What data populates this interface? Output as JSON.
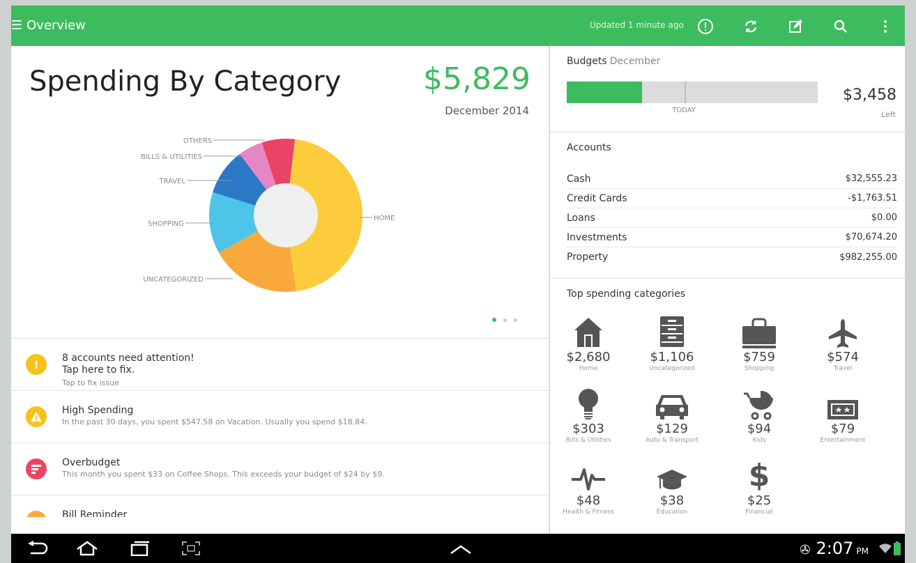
{
  "app": {
    "title": "Overview",
    "updated": "Updated 1 minute ago"
  },
  "toolbar": {
    "icons": [
      "alert-icon",
      "sync-icon",
      "compose-icon",
      "search-icon",
      "overflow-menu-icon"
    ]
  },
  "chart_title": "Spending By Category",
  "chart_total": "$5,829",
  "chart_period": "December 2014",
  "chart_data": {
    "type": "pie",
    "title": "Spending By Category",
    "categories": [
      "HOME",
      "UNCATEGORIZED",
      "SHOPPING",
      "TRAVEL",
      "BILLS & UTILITIES",
      "OTHERS"
    ],
    "values": [
      2680,
      1106,
      759,
      574,
      303,
      407
    ],
    "colors": [
      "#fccc3c",
      "#f9a93c",
      "#4ec5e8",
      "#2b78c7",
      "#e487c2",
      "#e94466"
    ],
    "donut": true
  },
  "pager": {
    "pages": 3,
    "active": 0
  },
  "alerts": [
    {
      "title": "8 accounts need attention!",
      "line2": "Tap here to fix.",
      "sub": "Tap to fix issue",
      "color": "#f8c21b",
      "icon": "exclamation-icon"
    },
    {
      "title": "High Spending",
      "sub": "In the past 30 days, you spent $547.58 on Vacation.  Usually you spend $18.84.",
      "color": "#f8c21b",
      "icon": "warning-icon"
    },
    {
      "title": "Overbudget",
      "sub": "This month you spent $33 on Coffee Shops. This exceeds your budget of $24 by $9.",
      "color": "#e94466",
      "icon": "overbudget-icon"
    },
    {
      "title": "Bill Reminder",
      "color": "#f9a93c",
      "icon": "bill-icon"
    }
  ],
  "budgets": {
    "title": "Budgets",
    "month": "December",
    "spent_fraction": 0.3,
    "today_fraction": 0.47,
    "today_label": "TODAY",
    "left_amount": "$3,458",
    "left_label": "Left"
  },
  "accounts": {
    "title": "Accounts",
    "rows": [
      {
        "name": "Cash",
        "value": "$32,555.23"
      },
      {
        "name": "Credit Cards",
        "value": "-$1,763.51"
      },
      {
        "name": "Loans",
        "value": "$0.00"
      },
      {
        "name": "Investments",
        "value": "$70,674.20"
      },
      {
        "name": "Property",
        "value": "$982,255.00"
      }
    ]
  },
  "top_spending": {
    "title": "Top spending categories",
    "items": [
      {
        "amount": "$2,680",
        "label": "Home",
        "icon": "home-icon"
      },
      {
        "amount": "$1,106",
        "label": "Uncategorized",
        "icon": "cabinet-icon"
      },
      {
        "amount": "$759",
        "label": "Shopping",
        "icon": "shopping-bag-icon"
      },
      {
        "amount": "$574",
        "label": "Travel",
        "icon": "airplane-icon"
      },
      {
        "amount": "$303",
        "label": "Bills & Utilities",
        "icon": "lightbulb-icon"
      },
      {
        "amount": "$129",
        "label": "Auto & Transport",
        "icon": "car-icon"
      },
      {
        "amount": "$94",
        "label": "Kids",
        "icon": "stroller-icon"
      },
      {
        "amount": "$79",
        "label": "Entertainment",
        "icon": "ticket-icon"
      },
      {
        "amount": "$48",
        "label": "Health & Fitness",
        "icon": "heartbeat-icon"
      },
      {
        "amount": "$38",
        "label": "Education",
        "icon": "graduation-cap-icon"
      },
      {
        "amount": "$25",
        "label": "Financial",
        "icon": "dollar-icon"
      }
    ]
  },
  "status": {
    "time": "2:07",
    "ampm": "PM"
  },
  "colors": {
    "brand": "#3dbb5f",
    "nav_bg": "#000000"
  }
}
